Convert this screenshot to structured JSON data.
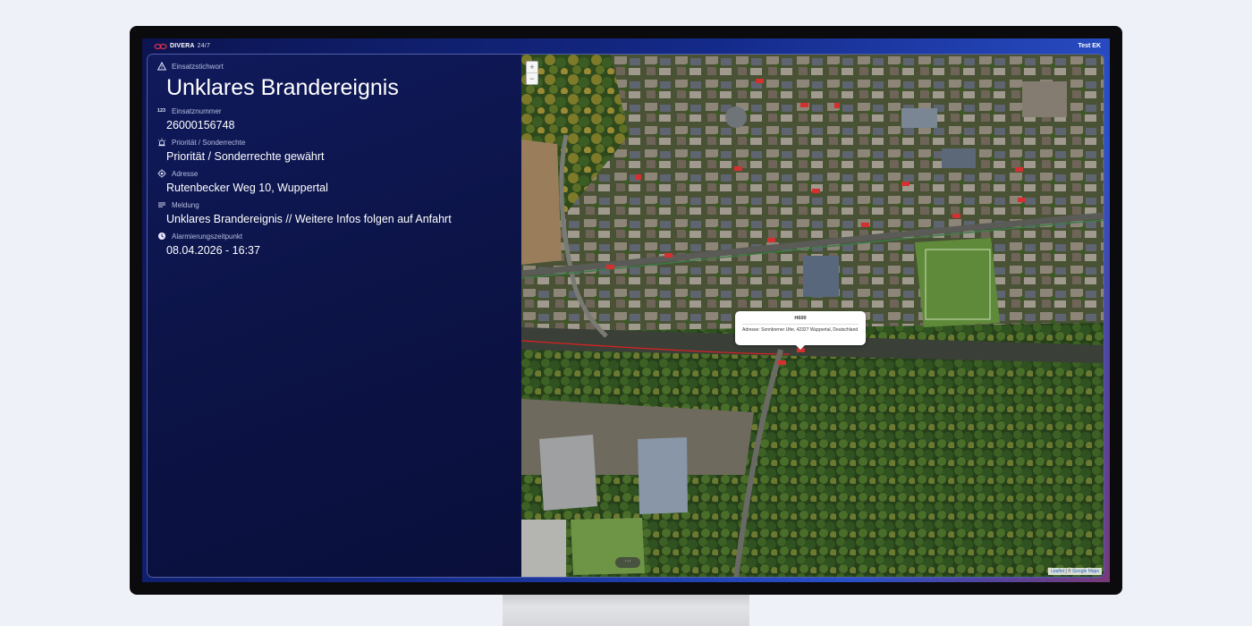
{
  "app": {
    "brand": "DIVERA",
    "brand_suffix": "24/7",
    "user": "Test EK"
  },
  "fields": {
    "stichwort": {
      "label": "Einsatzstichwort",
      "value": "Unklares Brandereignis"
    },
    "nummer": {
      "label": "Einsatznummer",
      "icon_text": "123",
      "value": "26000156748"
    },
    "prioritaet": {
      "label": "Priorität / Sonderrechte",
      "value": "Priorität / Sonderrechte gewährt"
    },
    "adresse": {
      "label": "Adresse",
      "value": "Rutenbecker Weg 10, Wuppertal"
    },
    "meldung": {
      "label": "Meldung",
      "value": "Unklares Brandereignis // Weitere Infos folgen auf Anfahrt"
    },
    "alarmierung": {
      "label": "Alarmierungszeitpunkt",
      "value": "08.04.2026 - 16:37"
    }
  },
  "map": {
    "zoom_in": "+",
    "zoom_out": "−",
    "popup_title": "H600",
    "popup_address": "Adresse: Sonnborner Ufer, 42327 Wuppertal, Deutschland",
    "more_button": "···",
    "attribution_leaflet": "Leaflet",
    "attribution_sep": " | © ",
    "attribution_google": "Google Maps"
  },
  "icons": {
    "warning": "warning-icon",
    "numbers": "numbers-icon",
    "siren": "siren-icon",
    "location": "location-icon",
    "message": "message-icon",
    "clock": "clock-icon"
  },
  "colors": {
    "screen_bg": "#142a8a",
    "panel_bg": "#0c1448",
    "brand_red": "#e0304a",
    "route_red": "#e02020"
  }
}
